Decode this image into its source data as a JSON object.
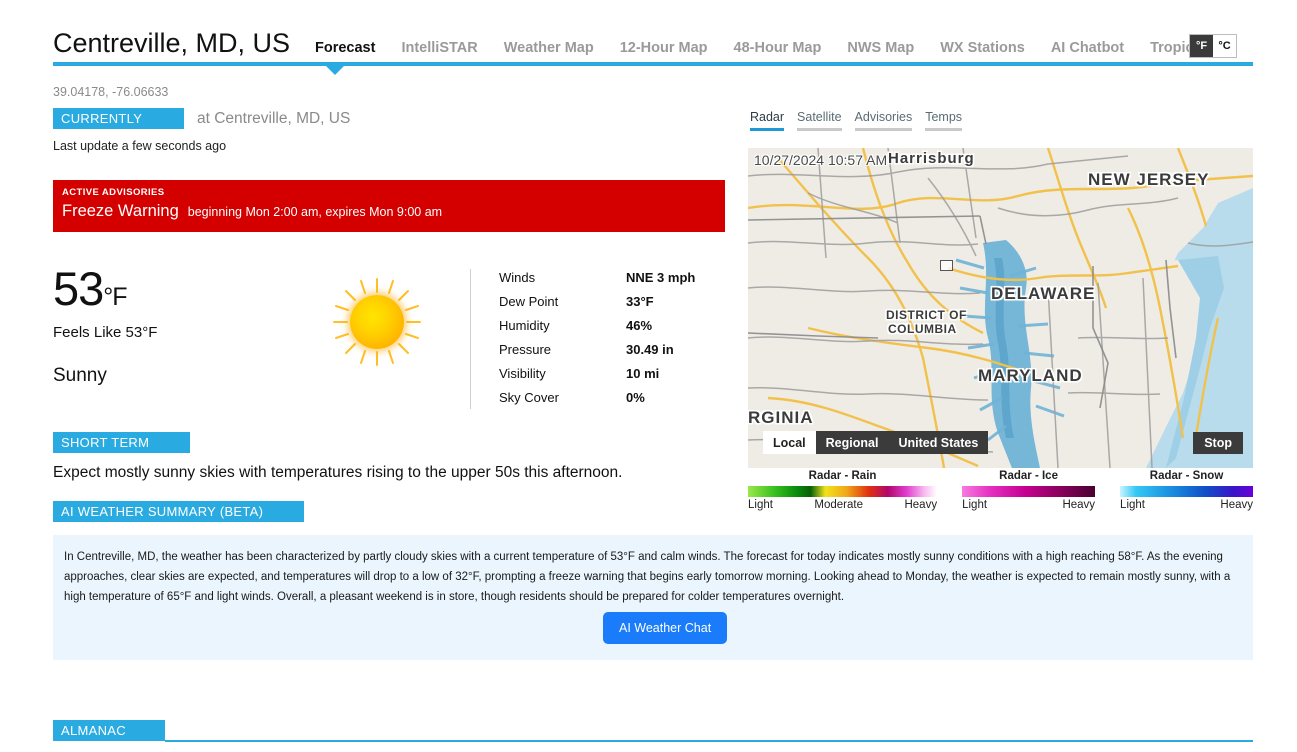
{
  "header": {
    "city_title": "Centreville, MD, US",
    "coords": "39.04178, -76.06633",
    "tabs": [
      {
        "label": "Forecast",
        "active": true
      },
      {
        "label": "IntelliSTAR",
        "active": false
      },
      {
        "label": "Weather Map",
        "active": false
      },
      {
        "label": "12-Hour Map",
        "active": false
      },
      {
        "label": "48-Hour Map",
        "active": false
      },
      {
        "label": "NWS Map",
        "active": false
      },
      {
        "label": "WX Stations",
        "active": false
      },
      {
        "label": "AI Chatbot",
        "active": false
      },
      {
        "label": "Tropical",
        "active": false
      }
    ],
    "unit_f": "°F",
    "unit_c": "°C",
    "unit_selected": "°F",
    "accent_color": "#29abe2"
  },
  "currently": {
    "badge": "CURRENTLY",
    "at_location": "at Centreville, MD, US",
    "last_update": "Last update a few seconds ago"
  },
  "advisory": {
    "label": "ACTIVE ADVISORIES",
    "title": "Freeze Warning",
    "detail": "beginning Mon 2:00 am, expires Mon 9:00 am",
    "color": "#d40000"
  },
  "current_conditions": {
    "temperature": "53",
    "temperature_unit": "°F",
    "feels_like": "Feels Like 53°F",
    "condition": "Sunny",
    "icon": "sun-icon",
    "details": [
      {
        "label": "Winds",
        "value": "NNE 3 mph"
      },
      {
        "label": "Dew Point",
        "value": "33°F"
      },
      {
        "label": "Humidity",
        "value": "46%"
      },
      {
        "label": "Pressure",
        "value": "30.49 in"
      },
      {
        "label": "Visibility",
        "value": "10 mi"
      },
      {
        "label": "Sky Cover",
        "value": "0%"
      }
    ]
  },
  "short_term": {
    "badge": "SHORT TERM",
    "text": "Expect mostly sunny skies with temperatures rising to the upper 50s this afternoon."
  },
  "ai_summary": {
    "badge": "AI WEATHER SUMMARY (BETA)",
    "text": "In Centreville, MD, the weather has been characterized by partly cloudy skies with a current temperature of 53°F and calm winds. The forecast for today indicates mostly sunny conditions with a high reaching 58°F. As the evening approaches, clear skies are expected, and temperatures will drop to a low of 32°F, prompting a freeze warning that begins early tomorrow morning. Looking ahead to Monday, the weather is expected to remain mostly sunny, with a high temperature of 65°F and light winds. Overall, a pleasant weekend is in store, though residents should be prepared for colder temperatures overnight.",
    "chat_button": "AI Weather Chat",
    "chat_button_color": "#1a7cfa"
  },
  "almanac": {
    "badge": "ALMANAC"
  },
  "map_panel": {
    "tabs": [
      {
        "label": "Radar",
        "active": true
      },
      {
        "label": "Satellite",
        "active": false
      },
      {
        "label": "Advisories",
        "active": false
      },
      {
        "label": "Temps",
        "active": false
      }
    ],
    "timestamp": "10/27/2024 10:57 AM",
    "labels": [
      {
        "text": "Harrisburg",
        "size": "15"
      },
      {
        "text": "NEW JERSEY",
        "size": "17"
      },
      {
        "text": "DELAWARE",
        "size": "17"
      },
      {
        "text": "DISTRICT OF",
        "size": "12"
      },
      {
        "text": "COLUMBIA",
        "size": "12"
      },
      {
        "text": "MARYLAND",
        "size": "17"
      },
      {
        "text": "RGINIA",
        "size": "17"
      }
    ],
    "scope_buttons": [
      {
        "label": "Local",
        "selected": true
      },
      {
        "label": "Regional",
        "selected": false
      },
      {
        "label": "United States",
        "selected": false
      }
    ],
    "stop_button": "Stop",
    "legends": [
      {
        "title": "Radar - Rain",
        "low": "Light",
        "mid": "Moderate",
        "high": "Heavy"
      },
      {
        "title": "Radar - Ice",
        "low": "Light",
        "mid": "",
        "high": "Heavy"
      },
      {
        "title": "Radar - Snow",
        "low": "Light",
        "mid": "",
        "high": "Heavy"
      }
    ]
  }
}
